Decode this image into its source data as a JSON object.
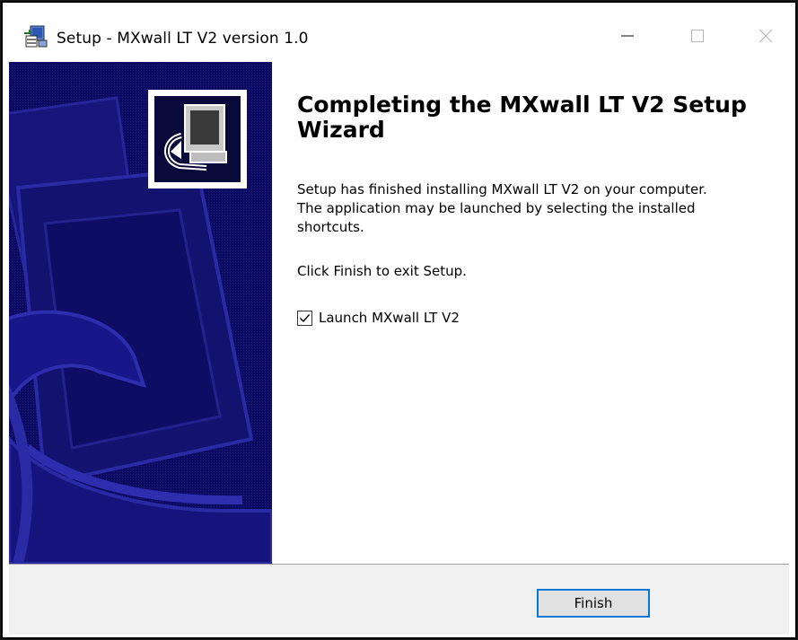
{
  "window": {
    "title": "Setup - MXwall LT V2 version 1.0",
    "icon": "installer-icon",
    "controls": {
      "minimize_icon": "minimize-icon",
      "maximize_icon": "maximize-icon",
      "close_icon": "close-icon"
    }
  },
  "banner": {
    "logo_icon": "computer-setup-icon",
    "background_color": "#0b0b62"
  },
  "main": {
    "heading": "Completing the MXwall LT V2 Setup Wizard",
    "paragraph_lines": [
      "Setup has finished installing MXwall LT V2 on your computer.",
      "The application may be launched by selecting the installed",
      "shortcuts."
    ],
    "instruction": "Click Finish to exit Setup.",
    "launch_checkbox": {
      "label": "Launch MXwall LT V2",
      "checked": true
    }
  },
  "footer": {
    "finish_label": "Finish",
    "accent_color": "#0078d7"
  }
}
